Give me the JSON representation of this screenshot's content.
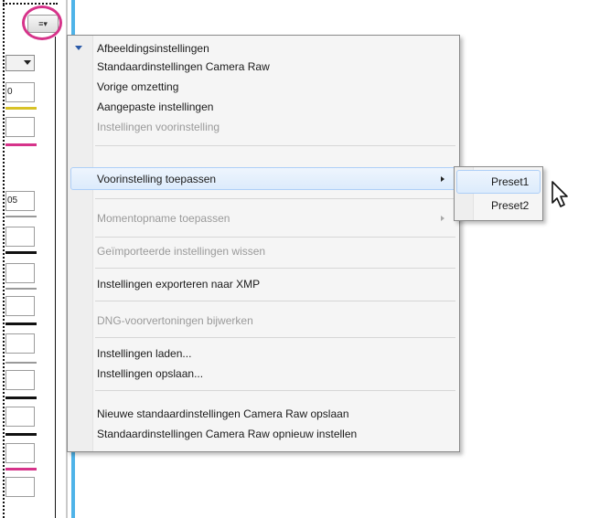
{
  "panel": {
    "fields": [
      "0",
      "",
      "",
      "05",
      "",
      "",
      "",
      "",
      "",
      "",
      "",
      ""
    ],
    "colors": {
      "yellow": "#d8c227",
      "magenta": "#d6338a",
      "black": "#111111",
      "grey": "#9a9a9a",
      "blue": "#4fb3e8"
    }
  },
  "menu": {
    "items": [
      {
        "label": "Afbeeldingsinstellingen",
        "enabled": true
      },
      {
        "label": "Standaardinstellingen Camera Raw",
        "enabled": true
      },
      {
        "label": "Vorige omzetting",
        "enabled": true
      },
      {
        "label": "Aangepaste instellingen",
        "enabled": true
      },
      {
        "label": "Instellingen voorinstelling",
        "enabled": false
      },
      {
        "label": "Voorinstelling toepassen",
        "enabled": true,
        "submenu": true,
        "highlighted": true
      },
      {
        "label": "Momentopname toepassen",
        "enabled": false,
        "submenu": true
      },
      {
        "label": "Geïmporteerde instellingen wissen",
        "enabled": false
      },
      {
        "label": "Instellingen exporteren naar XMP",
        "enabled": true
      },
      {
        "label": "DNG-voorvertoningen bijwerken",
        "enabled": false
      },
      {
        "label": "Instellingen laden...",
        "enabled": true
      },
      {
        "label": "Instellingen opslaan...",
        "enabled": true
      },
      {
        "label": "Nieuwe standaardinstellingen Camera Raw opslaan",
        "enabled": true
      },
      {
        "label": "Standaardinstellingen Camera Raw opnieuw instellen",
        "enabled": true
      }
    ]
  },
  "submenu": {
    "items": [
      {
        "label": "Preset1",
        "highlighted": true
      },
      {
        "label": "Preset2",
        "highlighted": false
      }
    ]
  },
  "icons": {
    "flyout": "flyout-menu-icon",
    "check": "selected-indicator-icon",
    "arrow": "submenu-arrow-icon",
    "cursor": "mouse-pointer-icon"
  }
}
